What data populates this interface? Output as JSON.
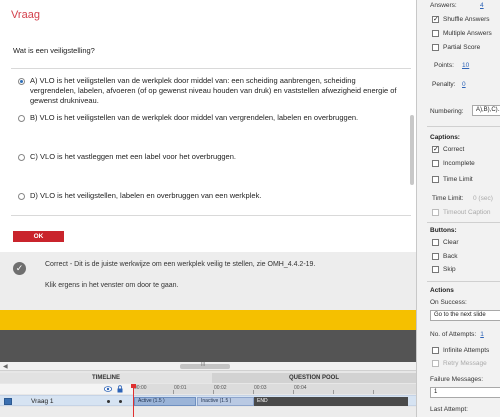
{
  "slide": {
    "title": "Vraag",
    "question": "Wat is een veiligstelling?",
    "answers": [
      {
        "label": "A)",
        "text": "VLO is het veiligstellen van de werkplek door middel van: een scheiding aanbrengen, scheiding vergrendelen, labelen, afvoeren (of op gewenst niveau houden van druk) en vaststellen afwezigheid energie of gewenst drukniveau.",
        "selected": true
      },
      {
        "label": "B)",
        "text": "VLO is het veiligstellen van de werkplek door middel van vergrendelen, labelen en overbruggen.",
        "selected": false
      },
      {
        "label": "C)",
        "text": "VLO is het vastleggen met een label voor het overbruggen.",
        "selected": false
      },
      {
        "label": "D)",
        "text": "VLO is het veiligstellen, labelen en overbruggen van een werkplek.",
        "selected": false
      }
    ],
    "ok_label": "OK",
    "feedback_line1": "Correct - Dit is de juiste werkwijze om een werkplek veilig te stellen, zie OMH_4.4.2-19.",
    "feedback_line2": "Klik ergens in het venster om door te gaan."
  },
  "timeline": {
    "tab_timeline": "TIMELINE",
    "tab_question_pool": "QUESTION POOL",
    "ticks": [
      "00:00",
      "00:01",
      "00:02",
      "00:03",
      "00:04"
    ],
    "layer_name": "Vraag 1",
    "bar_active": "Active (1.5 )",
    "bar_inactive": "Inactive (1.5 )",
    "bar_end": "END",
    "scroll_grip": "III"
  },
  "panel": {
    "answers_label": "Answers:",
    "answers_value": "4",
    "shuffle_answers": "Shuffle Answers",
    "multiple_answers": "Multiple Answers",
    "partial_score": "Partial Score",
    "points_label": "Points:",
    "points_value": "10",
    "penalty_label": "Penalty:",
    "penalty_value": "0",
    "numbering_label": "Numbering:",
    "numbering_value": "A),B),C)...",
    "captions_head": "Captions:",
    "caption_correct": "Correct",
    "caption_incomplete": "Incomplete",
    "caption_timelimit": "Time Limit",
    "timelimit_label": "Time Limit:",
    "timelimit_value": "0 (sec)",
    "timeout_caption": "Timeout Caption",
    "buttons_head": "Buttons:",
    "btn_clear": "Clear",
    "btn_back": "Back",
    "btn_skip": "Skip",
    "actions_head": "Actions",
    "on_success_label": "On Success:",
    "on_success_value": "Go to the next slide",
    "attempts_label": "No. of Attempts:",
    "attempts_value": "1",
    "infinite_attempts": "Infinite Attempts",
    "retry_message": "Retry Message",
    "failure_label": "Failure Messages:",
    "failure_value": "1",
    "last_attempt_label": "Last Attempt:"
  }
}
